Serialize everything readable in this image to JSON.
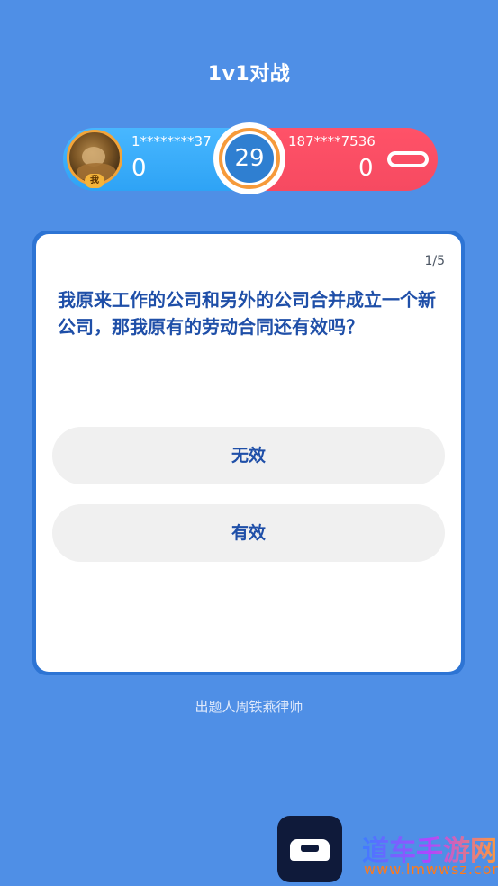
{
  "header": {
    "title": "1v1对战"
  },
  "battle": {
    "me_badge": "我",
    "player1": {
      "name": "1********37",
      "score": "0"
    },
    "timer": "29",
    "player2": {
      "name": "187****7536",
      "score": "0"
    }
  },
  "question": {
    "progress": "1/5",
    "text": "我原来工作的公司和另外的公司合并成立一个新公司，那我原有的劳动合同还有效吗？",
    "options": [
      {
        "label": "无效"
      },
      {
        "label": "有效"
      }
    ]
  },
  "footer": {
    "author": "出题人周铁燕律师"
  },
  "watermark": {
    "text": "道车手游网",
    "url": "www.lmwwsz.com"
  },
  "colors": {
    "background": "#4f8fe6",
    "player1": "#2ea3f5",
    "player2": "#f64a61",
    "timer_ring": "#f69a3a",
    "question_text": "#1f4fa8"
  }
}
